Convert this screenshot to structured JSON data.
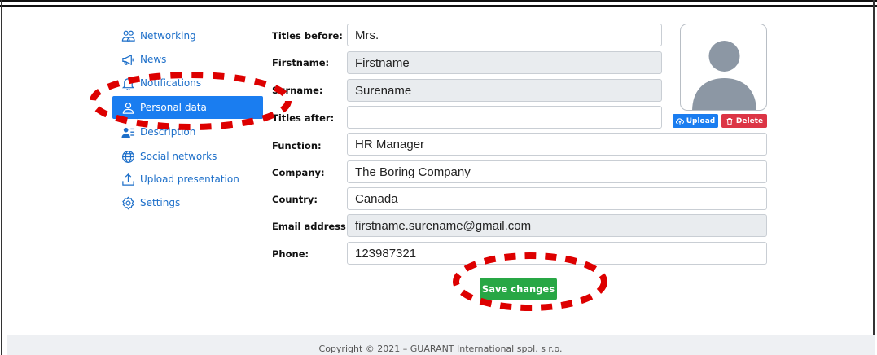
{
  "sidebar": {
    "items": [
      {
        "label": "Networking",
        "icon": "people-icon"
      },
      {
        "label": "News",
        "icon": "megaphone-icon"
      },
      {
        "label": "Notifications",
        "icon": "bell-icon"
      },
      {
        "label": "Personal data",
        "icon": "person-icon",
        "active": true
      },
      {
        "label": "Description",
        "icon": "person-list-icon"
      },
      {
        "label": "Social networks",
        "icon": "globe-icon"
      },
      {
        "label": "Upload presentation",
        "icon": "upload-icon"
      },
      {
        "label": "Settings",
        "icon": "gear-icon"
      }
    ]
  },
  "form": {
    "titles_before": {
      "label": "Titles before:",
      "value": "Mrs."
    },
    "firstname": {
      "label": "Firstname:",
      "value": "Firstname"
    },
    "surname": {
      "label": "Surname:",
      "value": "Surename"
    },
    "titles_after": {
      "label": "Titles after:",
      "value": ""
    },
    "function": {
      "label": "Function:",
      "value": "HR Manager"
    },
    "company": {
      "label": "Company:",
      "value": "The Boring Company"
    },
    "country": {
      "label": "Country:",
      "value": "Canada"
    },
    "email": {
      "label": "Email address:",
      "value": "firstname.surename@gmail.com"
    },
    "phone": {
      "label": "Phone:",
      "value": "123987321"
    }
  },
  "avatar": {
    "upload_label": "Upload",
    "delete_label": "Delete"
  },
  "actions": {
    "save_label": "Save changes"
  },
  "footer": {
    "copyright": "Copyright © 2021 – GUARANT International spol. s r.o."
  },
  "colors": {
    "primary": "#1a7df0",
    "success": "#28a745",
    "danger": "#dc3545",
    "highlight": "#dd0000"
  }
}
